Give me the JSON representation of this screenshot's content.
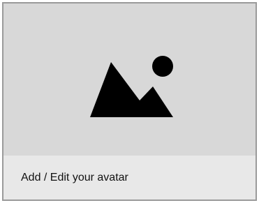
{
  "avatar_card": {
    "preview_icon": "image-placeholder-icon",
    "label": "Add / Edit your avatar"
  },
  "colors": {
    "preview_background": "#d8d8d8",
    "footer_background": "#e8e8e8",
    "border": "#9a9a9a",
    "icon": "#000000"
  }
}
